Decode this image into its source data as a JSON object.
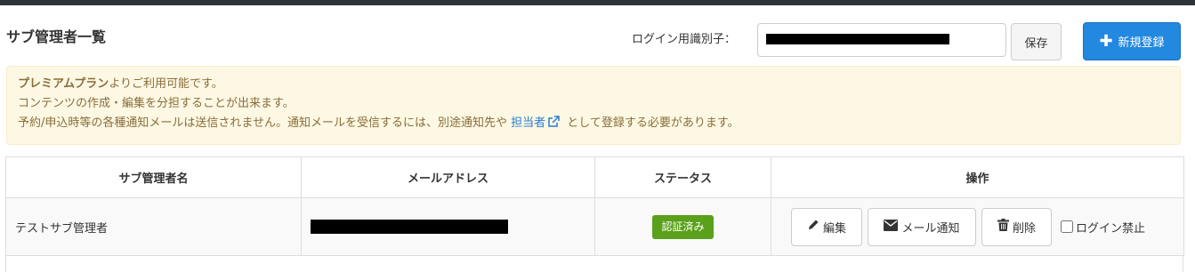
{
  "header": {
    "title": "サブ管理者一覧",
    "login_id_label": "ログイン用識別子：",
    "login_id_value": "",
    "save_label": "保存",
    "new_label": "新規登録"
  },
  "alert": {
    "plan_name": "プレミアムプラン",
    "plan_suffix": "よりご利用可能です。",
    "line2": "コンテンツの作成・編集を分担することが出来ます。",
    "line3_before": "予約/申込時等の各種通知メールは送信されません。通知メールを受信するには、別途通知先や",
    "line3_link": "担当者",
    "line3_after": "として登録する必要があります。"
  },
  "table": {
    "headers": [
      "サブ管理者名",
      "メールアドレス",
      "ステータス",
      "操作"
    ],
    "rows": [
      {
        "name": "テストサブ管理者",
        "email": "",
        "status": "認証済み",
        "edit_label": "編集",
        "mail_label": "メール通知",
        "delete_label": "削除",
        "ban_label": "ログイン禁止"
      }
    ]
  },
  "icons": {
    "new": "plus-icon",
    "link": "external-link-icon",
    "edit": "pencil-icon",
    "mail": "envelope-icon",
    "delete": "trash-icon"
  },
  "colors": {
    "primary": "#2389e0",
    "alert_bg": "#fcf8e3",
    "alert_text": "#8a6d3b",
    "link": "#2a7bd4",
    "status_badge": "#5aa01a"
  }
}
